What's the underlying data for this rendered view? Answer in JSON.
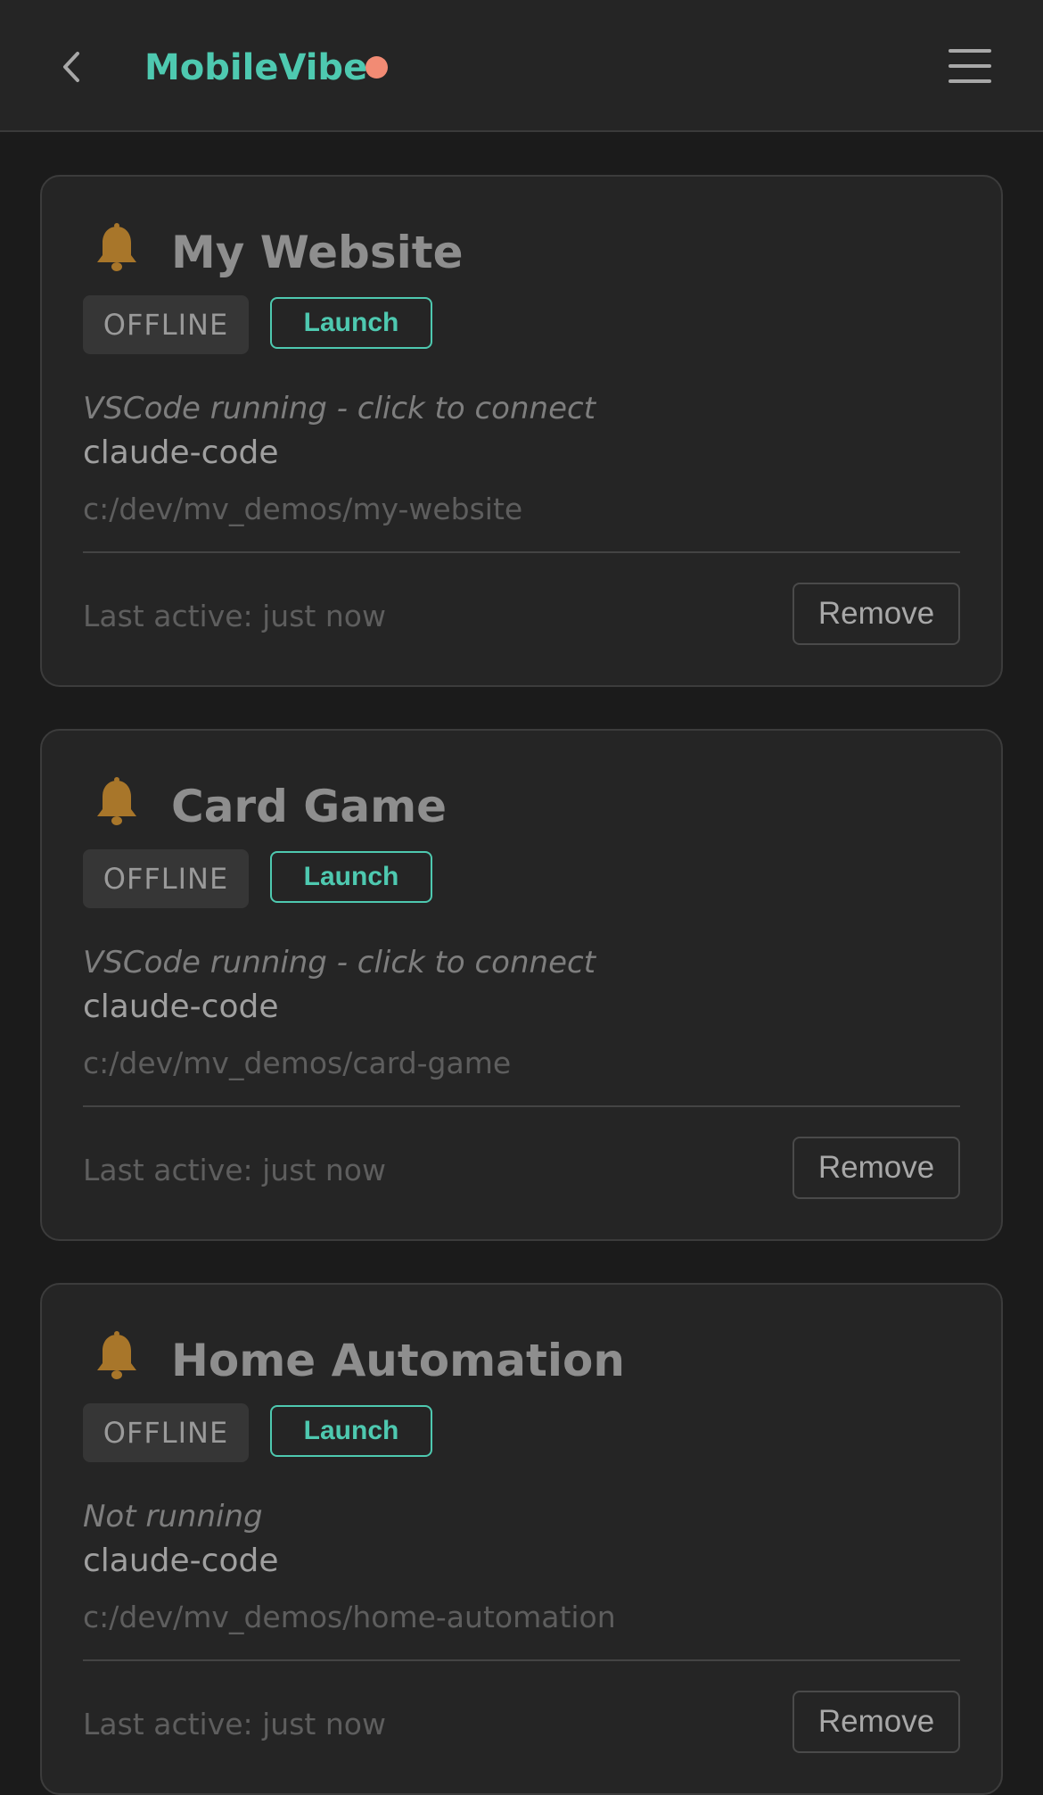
{
  "header": {
    "title": "MobileVibe",
    "back_icon": "chevron-left-icon",
    "menu_icon": "hamburger-menu-icon",
    "status_color": "#f28b74",
    "accent_color": "#4ec9b0"
  },
  "projects": [
    {
      "name": "My Website",
      "badge": "OFFLINE",
      "launch_label": "Launch",
      "status": "VSCode running - click to connect",
      "agent": "claude-code",
      "path": "c:/dev/mv_demos/my-website",
      "last_active": "Last active: just now",
      "remove_label": "Remove"
    },
    {
      "name": "Card Game",
      "badge": "OFFLINE",
      "launch_label": "Launch",
      "status": "VSCode running - click to connect",
      "agent": "claude-code",
      "path": "c:/dev/mv_demos/card-game",
      "last_active": "Last active: just now",
      "remove_label": "Remove"
    },
    {
      "name": "Home Automation",
      "badge": "OFFLINE",
      "launch_label": "Launch",
      "status": "Not running",
      "agent": "claude-code",
      "path": "c:/dev/mv_demos/home-automation",
      "last_active": "Last active: just now",
      "remove_label": "Remove"
    }
  ]
}
